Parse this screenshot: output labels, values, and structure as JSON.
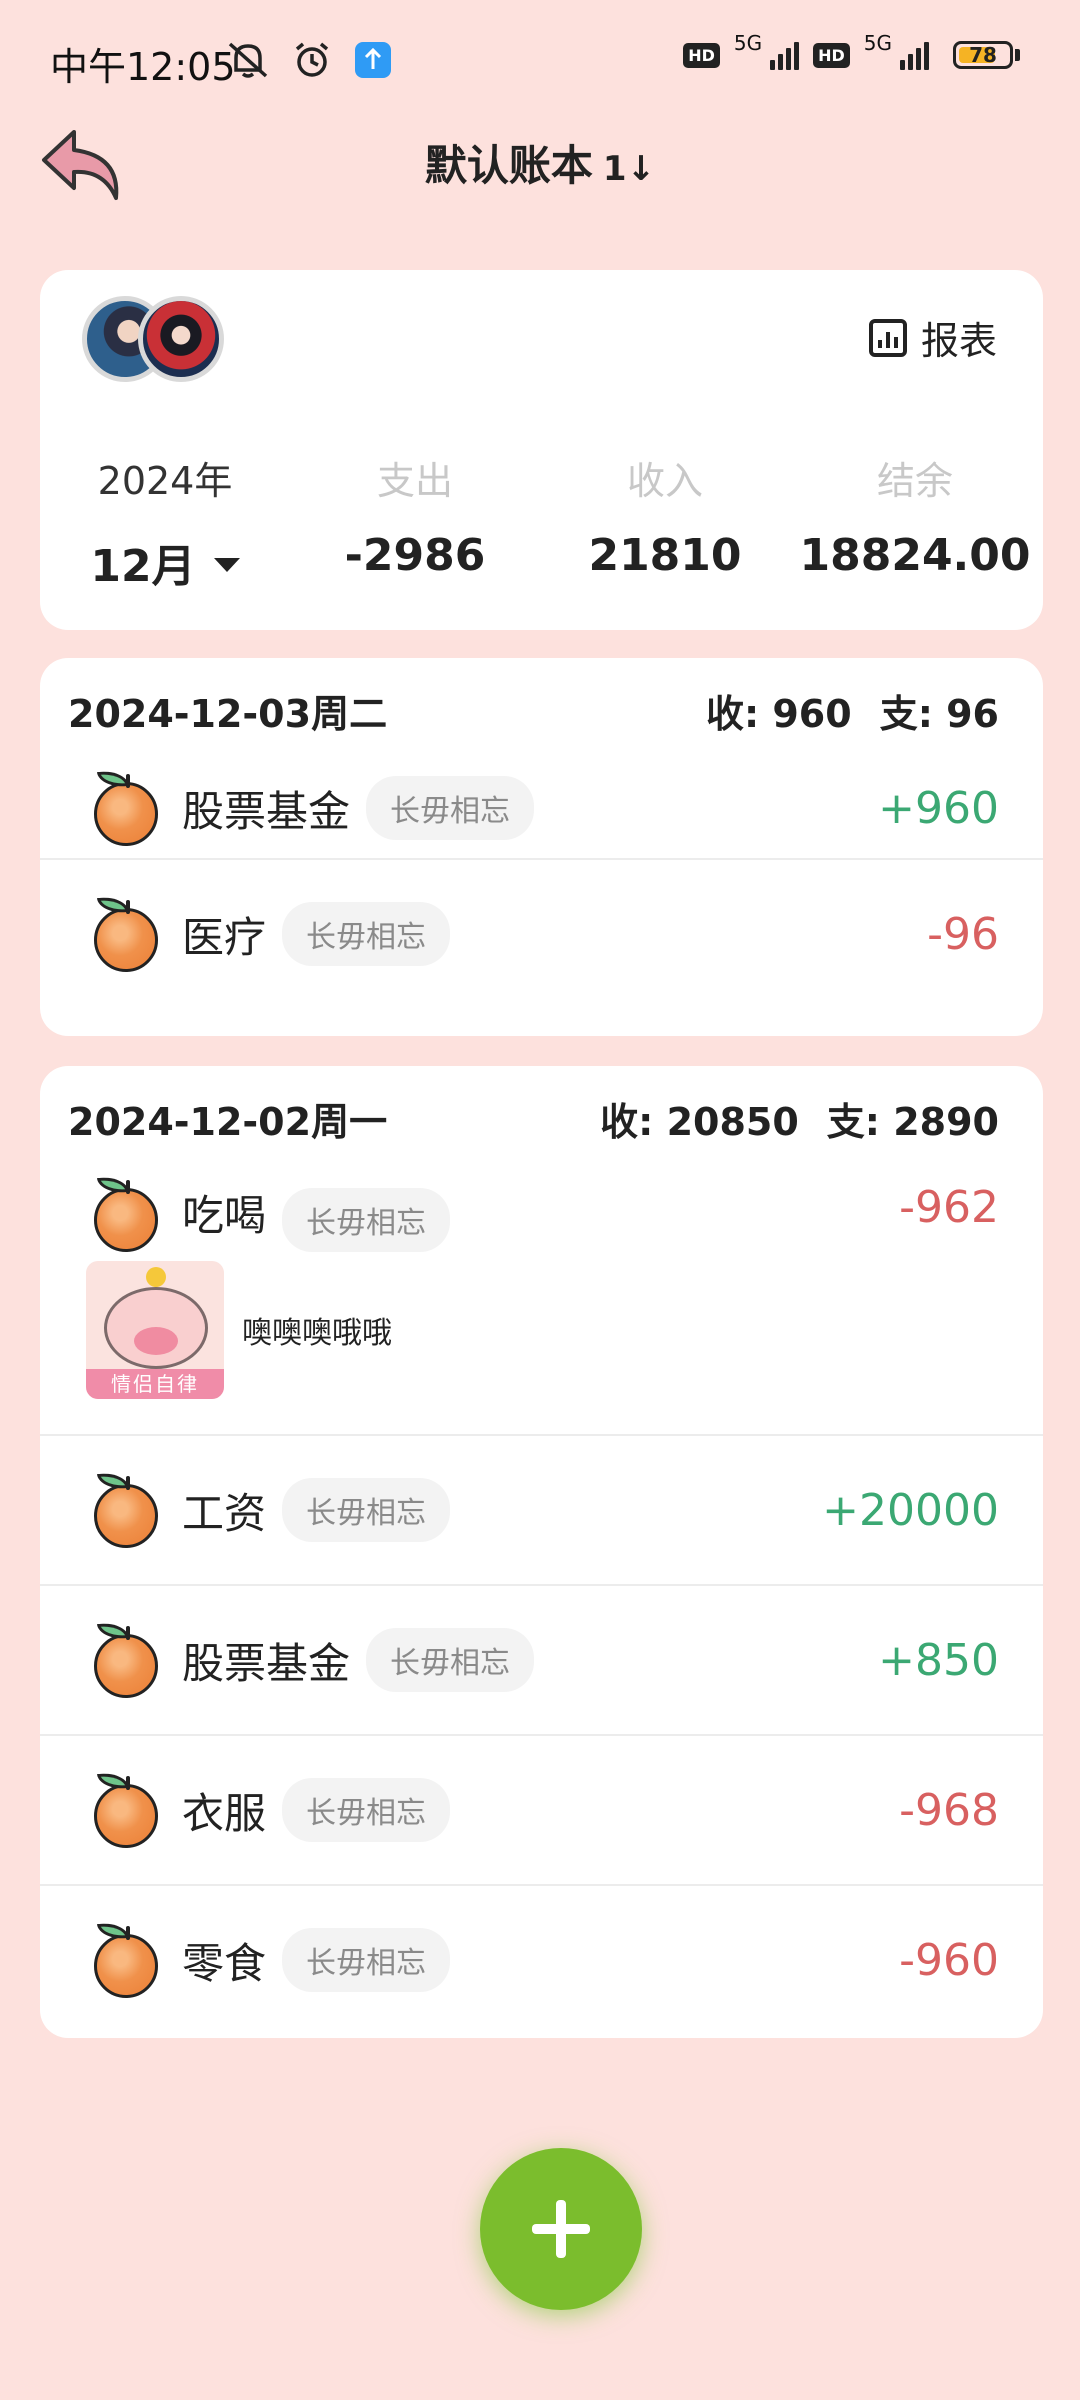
{
  "status_bar": {
    "time": "中午12:05",
    "network_1": "5G",
    "network_2": "5G",
    "hd_1": "HD",
    "hd_2": "HD",
    "battery_level": "78",
    "battery_fraction": 0.78,
    "icons": [
      "mute-bell-icon",
      "alarm-icon",
      "app-notification-icon"
    ]
  },
  "header": {
    "title": "默认账本",
    "sort_icon": "1↓",
    "back_icon": "back-arrow-icon"
  },
  "summary": {
    "report_label": "报表",
    "year": "2024年",
    "month": "12月",
    "expense_label": "支出",
    "expense_value": "-2986",
    "income_label": "收入",
    "income_value": "21810",
    "balance_label": "结余",
    "balance_value": "18824.00"
  },
  "days": [
    {
      "date": "2024-12-03周二",
      "income_total": "收: 960",
      "expense_total": "支: 96",
      "entries": [
        {
          "category": "股票基金",
          "tag": "长毋相忘",
          "amount": "+960",
          "type": "income"
        },
        {
          "category": "医疗",
          "tag": "长毋相忘",
          "amount": "-96",
          "type": "expense"
        }
      ]
    },
    {
      "date": "2024-12-02周一",
      "income_total": "收: 20850",
      "expense_total": "支: 2890",
      "entries": [
        {
          "category": "吃喝",
          "tag": "长毋相忘",
          "amount": "-962",
          "type": "expense",
          "note": "噢噢噢哦哦",
          "thumb_label": "情侣自律"
        },
        {
          "category": "工资",
          "tag": "长毋相忘",
          "amount": "+20000",
          "type": "income"
        },
        {
          "category": "股票基金",
          "tag": "长毋相忘",
          "amount": "+850",
          "type": "income"
        },
        {
          "category": "衣服",
          "tag": "长毋相忘",
          "amount": "-968",
          "type": "expense"
        },
        {
          "category": "零食",
          "tag": "长毋相忘",
          "amount": "-960",
          "type": "expense"
        }
      ]
    }
  ],
  "colors": {
    "background": "#fde1dd",
    "income": "#3ba873",
    "expense": "#d86060",
    "fab": "#7bbd2d",
    "back_arrow": "#e89aa8"
  }
}
